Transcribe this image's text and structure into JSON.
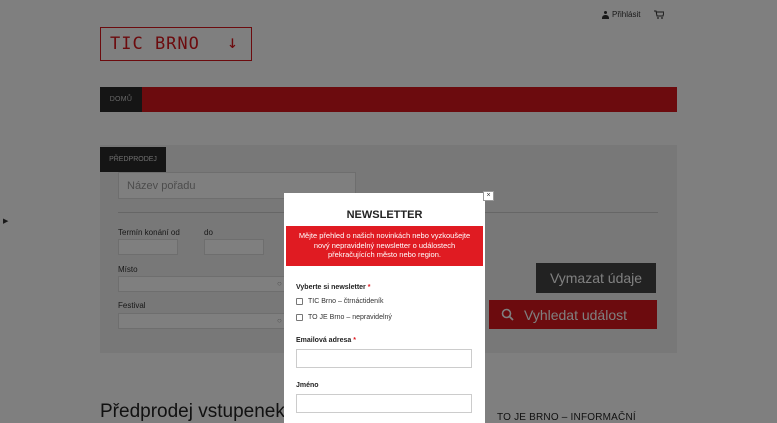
{
  "header": {
    "login_label": "Přihlásit",
    "logo_text": "TIC BRNO",
    "logo_arrow": "↓"
  },
  "nav": {
    "home_label": "DOMŮ"
  },
  "search": {
    "tab_label": "PŘEDPRODEJ",
    "event_placeholder": "Název pořadu",
    "date_from_label": "Termín konání od",
    "date_to_label": "do",
    "place_label": "Místo",
    "festival_label": "Festival",
    "clear_label": "Vymazat údaje",
    "search_label": "Vyhledat událost"
  },
  "content": {
    "section_title": "Předprodej vstupenek",
    "side_title": "TO JE BRNO – INFORMAČNÍ"
  },
  "modal": {
    "close_label": "×",
    "title": "NEWSLETTER",
    "description": "Mějte přehled o našich novinkách nebo vyzkoušejte nový nepravidelný newsletter o událostech překračujících město nebo region.",
    "choose_label": "Vyberte si newsletter",
    "required_mark": "*",
    "options": [
      "TIC Brno – čtrnáctideník",
      "TO JE Brno – nepravidelný"
    ],
    "email_label": "Emailová adresa",
    "name_label": "Jméno"
  },
  "colors": {
    "brand_red": "#d8161c",
    "dark": "#2b2b2b"
  }
}
